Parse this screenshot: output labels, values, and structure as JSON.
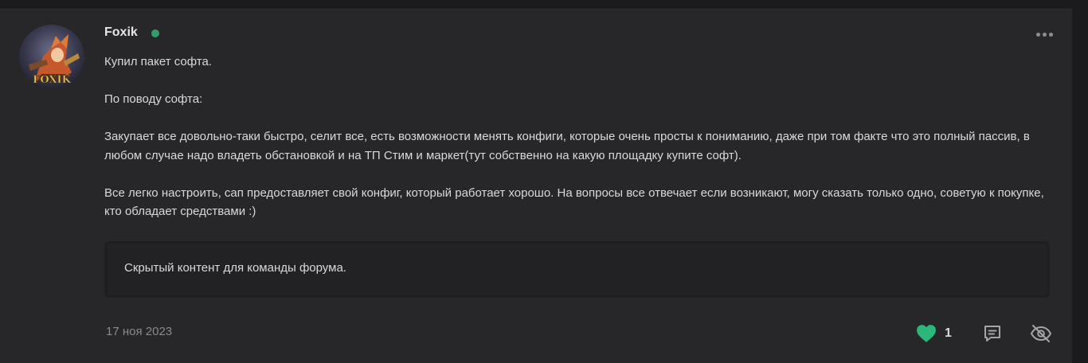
{
  "post": {
    "author": "Foxik",
    "avatar_text": "FOXIK",
    "online_color": "#2f9e6c",
    "paragraphs": [
      "Купил пакет софта.",
      "По поводу софта:",
      "Закупает все довольно-таки быстро, селит все, есть возможности менять конфиги, которые очень просты к пониманию, даже при том факте что это полный пассив, в любом случае надо владеть обстановкой и на ТП Стим и маркет(тут собственно на какую площадку купите софт).",
      "Все легко настроить, сап предоставляет свой конфиг, который работает хорошо. На вопросы все отвечает если возникают, могу сказать только одно, советую к покупке, кто обладает средствами :)"
    ],
    "hidden_content": "Скрытый контент для команды форума.",
    "date": "17 ноя 2023",
    "like_count": "1",
    "like_color": "#2bb77a",
    "icons": [
      "heart-icon",
      "comment-icon",
      "eye-off-icon",
      "more-icon"
    ]
  }
}
